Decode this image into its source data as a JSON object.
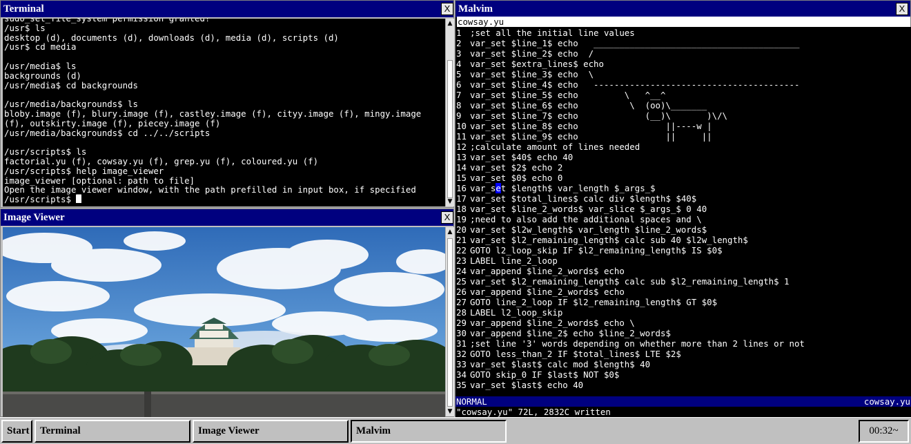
{
  "terminal": {
    "title": "Terminal",
    "close_label": "X",
    "lines": [
      "sudo_set_file_system permission granted!",
      "/usr$ ls",
      "desktop (d), documents (d), downloads (d), media (d), scripts (d)",
      "/usr$ cd media",
      "",
      "/usr/media$ ls",
      "backgrounds (d)",
      "/usr/media$ cd backgrounds",
      "",
      "/usr/media/backgrounds$ ls",
      "bloby.image (f), blury.image (f), castley.image (f), cityy.image (f), mingy.image",
      "(f), outskirty.image (f), piecey.image (f)",
      "/usr/media/backgrounds$ cd ../../scripts",
      "",
      "/usr/scripts$ ls",
      "factorial.yu (f), cowsay.yu (f), grep.yu (f), coloured.yu (f)",
      "/usr/scripts$ help image_viewer",
      "image_viewer [optional: path to file]",
      "Open the image_viewer window, with the path prefilled in input box, if specified"
    ],
    "prompt": "/usr/scripts$ "
  },
  "image_viewer": {
    "title": "Image Viewer",
    "close_label": "X"
  },
  "malvim": {
    "title": "Malvim",
    "close_label": "X",
    "command_input": "cowsay.yu",
    "cursor_line": 16,
    "cursor_col": 5,
    "lines": [
      ";set all the initial line values",
      "var_set $line_1$ echo   ________________________________________",
      "var_set $line_2$ echo  /",
      "var_set $extra_lines$ echo",
      "var_set $line_3$ echo  \\",
      "var_set $line_4$ echo   ----------------------------------------",
      "var_set $line_5$ echo         \\   ^__^",
      "var_set $line_6$ echo          \\  (oo)\\_______",
      "var_set $line_7$ echo             (__)\\       )\\/\\",
      "var_set $line_8$ echo                 ||----w |",
      "var_set $line_9$ echo                 ||     ||",
      ";calculate amount of lines needed",
      "var_set $40$ echo 40",
      "var_set $2$ echo 2",
      "var_set $0$ echo 0",
      "var_set $length$ var_length $_args_$",
      "var_set $total_lines$ calc div $length$ $40$",
      "var_set $line_2_words$ var_slice $_args_$ 0 40",
      ";need to also add the additional spaces and \\",
      "var_set $l2w_length$ var_length $line_2_words$",
      "var_set $l2_remaining_length$ calc sub 40 $l2w_length$",
      "GOTO l2_loop_skip IF $l2_remaining_length$ IS $0$",
      "LABEL line_2_loop",
      "var_append $line_2_words$ echo",
      "var_set $l2_remaining_length$ calc sub $l2_remaining_length$ 1",
      "var_append $line_2_words$ echo",
      "GOTO line_2_loop IF $l2_remaining_length$ GT $0$",
      "LABEL l2_loop_skip",
      "var_append $line_2_words$ echo \\",
      "var_append $line_2$ echo $line_2_words$",
      ";set line '3' words depending on whether more than 2 lines or not",
      "GOTO less_than_2 IF $total_lines$ LTE $2$",
      "var_set $last$ calc mod $length$ 40",
      "GOTO skip_0 IF $last$ NOT $0$",
      "var_set $last$ echo 40"
    ],
    "mode": "NORMAL",
    "status_filename": "cowsay.yu",
    "message": "\"cowsay.yu\" 72L, 2832C written"
  },
  "taskbar": {
    "start_label": "Start",
    "items": [
      "Terminal",
      "Image Viewer",
      "Malvim"
    ],
    "active_item": "Malvim",
    "clock": "00:32~"
  },
  "colors": {
    "titlebar": "#00007f",
    "desktop": "#c0c0c0",
    "terminal_bg": "#000000",
    "cursor_highlight": "#0000ff"
  }
}
